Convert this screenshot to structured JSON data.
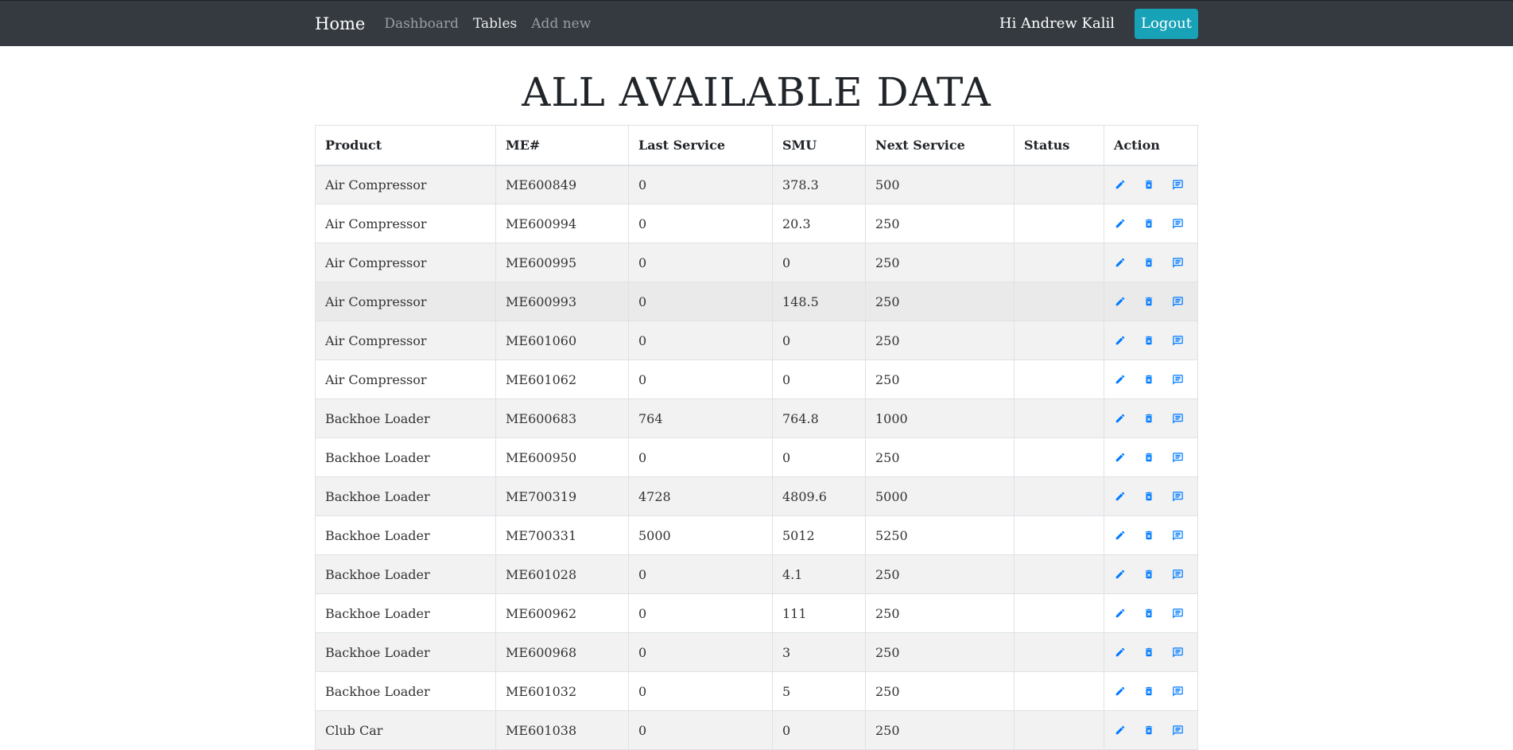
{
  "nav": {
    "brand": "Home",
    "links": [
      "Dashboard",
      "Tables",
      "Add new"
    ],
    "greeting": "Hi Andrew Kalil",
    "logout": "Logout"
  },
  "page_title": "ALL AVAILABLE DATA",
  "table": {
    "headers": [
      "Product",
      "ME#",
      "Last Service",
      "SMU",
      "Next Service",
      "Status",
      "Action"
    ],
    "rows": [
      [
        "Air Compressor",
        "ME600849",
        "0",
        "378.3",
        "500",
        ""
      ],
      [
        "Air Compressor",
        "ME600994",
        "0",
        "20.3",
        "250",
        ""
      ],
      [
        "Air Compressor",
        "ME600995",
        "0",
        "0",
        "250",
        ""
      ],
      [
        "Air Compressor",
        "ME600993",
        "0",
        "148.5",
        "250",
        ""
      ],
      [
        "Air Compressor",
        "ME601060",
        "0",
        "0",
        "250",
        ""
      ],
      [
        "Air Compressor",
        "ME601062",
        "0",
        "0",
        "250",
        ""
      ],
      [
        "Backhoe Loader",
        "ME600683",
        "764",
        "764.8",
        "1000",
        ""
      ],
      [
        "Backhoe Loader",
        "ME600950",
        "0",
        "0",
        "250",
        ""
      ],
      [
        "Backhoe Loader",
        "ME700319",
        "4728",
        "4809.6",
        "5000",
        ""
      ],
      [
        "Backhoe Loader",
        "ME700331",
        "5000",
        "5012",
        "5250",
        ""
      ],
      [
        "Backhoe Loader",
        "ME601028",
        "0",
        "4.1",
        "250",
        ""
      ],
      [
        "Backhoe Loader",
        "ME600962",
        "0",
        "111",
        "250",
        ""
      ],
      [
        "Backhoe Loader",
        "ME600968",
        "0",
        "3",
        "250",
        ""
      ],
      [
        "Backhoe Loader",
        "ME601032",
        "0",
        "5",
        "250",
        ""
      ],
      [
        "Club Car",
        "ME601038",
        "0",
        "0",
        "250",
        ""
      ]
    ],
    "action_icons": [
      "edit-icon",
      "delete-icon",
      "comment-icon"
    ]
  },
  "colors": {
    "navbar": "#343a40",
    "logout_button": "#17a2b8",
    "icon_blue": "#007bff",
    "row_stripe": "#f2f2f2"
  }
}
